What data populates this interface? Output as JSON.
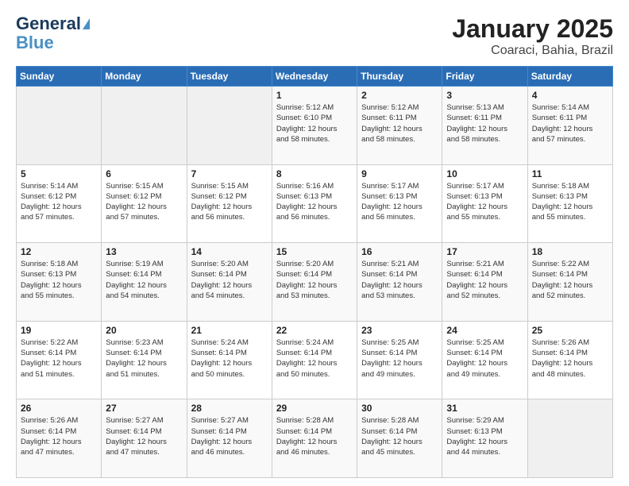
{
  "logo": {
    "line1": "General",
    "line2": "Blue"
  },
  "title": "January 2025",
  "subtitle": "Coaraci, Bahia, Brazil",
  "weekdays": [
    "Sunday",
    "Monday",
    "Tuesday",
    "Wednesday",
    "Thursday",
    "Friday",
    "Saturday"
  ],
  "weeks": [
    [
      {
        "day": "",
        "info": ""
      },
      {
        "day": "",
        "info": ""
      },
      {
        "day": "",
        "info": ""
      },
      {
        "day": "1",
        "info": "Sunrise: 5:12 AM\nSunset: 6:10 PM\nDaylight: 12 hours\nand 58 minutes."
      },
      {
        "day": "2",
        "info": "Sunrise: 5:12 AM\nSunset: 6:11 PM\nDaylight: 12 hours\nand 58 minutes."
      },
      {
        "day": "3",
        "info": "Sunrise: 5:13 AM\nSunset: 6:11 PM\nDaylight: 12 hours\nand 58 minutes."
      },
      {
        "day": "4",
        "info": "Sunrise: 5:14 AM\nSunset: 6:11 PM\nDaylight: 12 hours\nand 57 minutes."
      }
    ],
    [
      {
        "day": "5",
        "info": "Sunrise: 5:14 AM\nSunset: 6:12 PM\nDaylight: 12 hours\nand 57 minutes."
      },
      {
        "day": "6",
        "info": "Sunrise: 5:15 AM\nSunset: 6:12 PM\nDaylight: 12 hours\nand 57 minutes."
      },
      {
        "day": "7",
        "info": "Sunrise: 5:15 AM\nSunset: 6:12 PM\nDaylight: 12 hours\nand 56 minutes."
      },
      {
        "day": "8",
        "info": "Sunrise: 5:16 AM\nSunset: 6:13 PM\nDaylight: 12 hours\nand 56 minutes."
      },
      {
        "day": "9",
        "info": "Sunrise: 5:17 AM\nSunset: 6:13 PM\nDaylight: 12 hours\nand 56 minutes."
      },
      {
        "day": "10",
        "info": "Sunrise: 5:17 AM\nSunset: 6:13 PM\nDaylight: 12 hours\nand 55 minutes."
      },
      {
        "day": "11",
        "info": "Sunrise: 5:18 AM\nSunset: 6:13 PM\nDaylight: 12 hours\nand 55 minutes."
      }
    ],
    [
      {
        "day": "12",
        "info": "Sunrise: 5:18 AM\nSunset: 6:13 PM\nDaylight: 12 hours\nand 55 minutes."
      },
      {
        "day": "13",
        "info": "Sunrise: 5:19 AM\nSunset: 6:14 PM\nDaylight: 12 hours\nand 54 minutes."
      },
      {
        "day": "14",
        "info": "Sunrise: 5:20 AM\nSunset: 6:14 PM\nDaylight: 12 hours\nand 54 minutes."
      },
      {
        "day": "15",
        "info": "Sunrise: 5:20 AM\nSunset: 6:14 PM\nDaylight: 12 hours\nand 53 minutes."
      },
      {
        "day": "16",
        "info": "Sunrise: 5:21 AM\nSunset: 6:14 PM\nDaylight: 12 hours\nand 53 minutes."
      },
      {
        "day": "17",
        "info": "Sunrise: 5:21 AM\nSunset: 6:14 PM\nDaylight: 12 hours\nand 52 minutes."
      },
      {
        "day": "18",
        "info": "Sunrise: 5:22 AM\nSunset: 6:14 PM\nDaylight: 12 hours\nand 52 minutes."
      }
    ],
    [
      {
        "day": "19",
        "info": "Sunrise: 5:22 AM\nSunset: 6:14 PM\nDaylight: 12 hours\nand 51 minutes."
      },
      {
        "day": "20",
        "info": "Sunrise: 5:23 AM\nSunset: 6:14 PM\nDaylight: 12 hours\nand 51 minutes."
      },
      {
        "day": "21",
        "info": "Sunrise: 5:24 AM\nSunset: 6:14 PM\nDaylight: 12 hours\nand 50 minutes."
      },
      {
        "day": "22",
        "info": "Sunrise: 5:24 AM\nSunset: 6:14 PM\nDaylight: 12 hours\nand 50 minutes."
      },
      {
        "day": "23",
        "info": "Sunrise: 5:25 AM\nSunset: 6:14 PM\nDaylight: 12 hours\nand 49 minutes."
      },
      {
        "day": "24",
        "info": "Sunrise: 5:25 AM\nSunset: 6:14 PM\nDaylight: 12 hours\nand 49 minutes."
      },
      {
        "day": "25",
        "info": "Sunrise: 5:26 AM\nSunset: 6:14 PM\nDaylight: 12 hours\nand 48 minutes."
      }
    ],
    [
      {
        "day": "26",
        "info": "Sunrise: 5:26 AM\nSunset: 6:14 PM\nDaylight: 12 hours\nand 47 minutes."
      },
      {
        "day": "27",
        "info": "Sunrise: 5:27 AM\nSunset: 6:14 PM\nDaylight: 12 hours\nand 47 minutes."
      },
      {
        "day": "28",
        "info": "Sunrise: 5:27 AM\nSunset: 6:14 PM\nDaylight: 12 hours\nand 46 minutes."
      },
      {
        "day": "29",
        "info": "Sunrise: 5:28 AM\nSunset: 6:14 PM\nDaylight: 12 hours\nand 46 minutes."
      },
      {
        "day": "30",
        "info": "Sunrise: 5:28 AM\nSunset: 6:14 PM\nDaylight: 12 hours\nand 45 minutes."
      },
      {
        "day": "31",
        "info": "Sunrise: 5:29 AM\nSunset: 6:13 PM\nDaylight: 12 hours\nand 44 minutes."
      },
      {
        "day": "",
        "info": ""
      }
    ]
  ]
}
